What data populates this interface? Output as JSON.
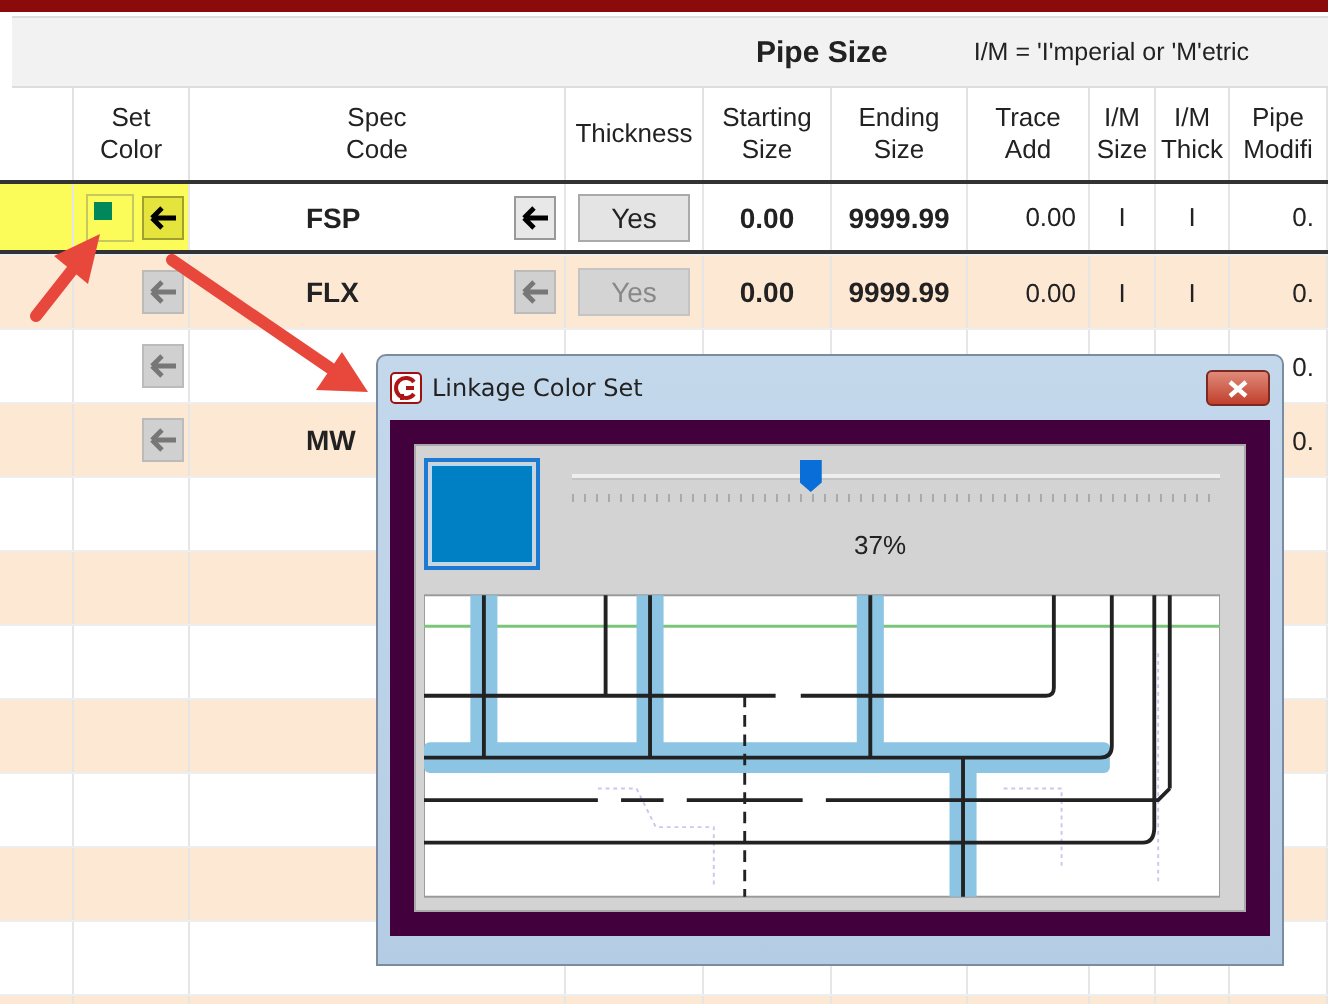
{
  "header_band": {
    "title": "Pipe Size",
    "note": "I/M = 'I'mperial or 'M'etric"
  },
  "table": {
    "columns": [
      "",
      "Set\nColor",
      "Spec\nCode",
      "Thickness",
      "Starting\nSize",
      "Ending\nSize",
      "Trace\nAdd",
      "I/M\nSize",
      "I/M\nThick",
      "Pipe\nModifi"
    ],
    "rows": [
      {
        "selected": true,
        "highlighted": true,
        "disabled": false,
        "swatch": {
          "color": "#00875a"
        },
        "spec_code": "FSP",
        "thickness": "Yes",
        "starting_size": "0.00",
        "ending_size": "9999.99",
        "trace_add": "0.00",
        "im_size": "I",
        "im_thick": "I",
        "pipe_modifier": "0."
      },
      {
        "selected": false,
        "highlighted": false,
        "disabled": true,
        "spec_code": "FLX",
        "thickness": "Yes",
        "starting_size": "0.00",
        "ending_size": "9999.99",
        "trace_add": "0.00",
        "im_size": "I",
        "im_thick": "I",
        "pipe_modifier": "0."
      },
      {
        "selected": false,
        "highlighted": false,
        "disabled": true,
        "pipe_modifier": "0."
      },
      {
        "selected": false,
        "highlighted": false,
        "disabled": true,
        "spec_code": "MW",
        "pipe_modifier": "0."
      }
    ]
  },
  "dialog": {
    "title": "Linkage Color Set",
    "color": "#0080c4",
    "opacity": {
      "level": 0.37,
      "reading": "37%"
    }
  }
}
